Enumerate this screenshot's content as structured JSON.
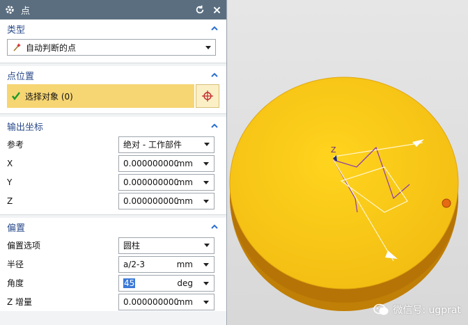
{
  "title": "点",
  "type_section": {
    "header": "类型",
    "selected": "自动判断的点"
  },
  "point_location": {
    "header": "点位置",
    "select_object_label": "选择对象 (0)"
  },
  "output_coords": {
    "header": "输出坐标",
    "reference_label": "参考",
    "reference_value": "绝对 - 工作部件",
    "rows": [
      {
        "label": "X",
        "value": "0.0000000000",
        "unit": "mm"
      },
      {
        "label": "Y",
        "value": "0.0000000000",
        "unit": "mm"
      },
      {
        "label": "Z",
        "value": "0.0000000000",
        "unit": "mm"
      }
    ]
  },
  "offset": {
    "header": "偏置",
    "option_label": "偏置选项",
    "option_value": "圆柱",
    "radius_label": "半径",
    "radius_value": "a/2-3",
    "radius_unit": "mm",
    "angle_label": "角度",
    "angle_value": "45",
    "angle_unit": "deg",
    "zinc_label": "Z 增量",
    "zinc_value": "0.0000000000",
    "zinc_unit": "mm"
  },
  "viewport": {
    "axis_label": "Z",
    "watermark": "微信号: ugprat"
  },
  "colors": {
    "title_bar": "#5a6e80",
    "header_text": "#2a4a8a",
    "disk": "#f5c419",
    "selection": "#f6d573"
  },
  "icons": [
    "gear-icon",
    "reset-icon",
    "close-icon",
    "chevron-up-icon",
    "wand-icon",
    "checkmark-icon",
    "crosshair-icon",
    "chevron-down-icon",
    "wechat-icon"
  ]
}
